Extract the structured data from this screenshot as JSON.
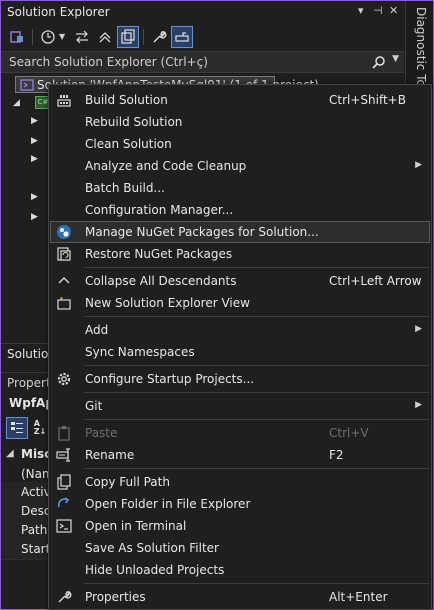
{
  "solution_explorer": {
    "title": "Solution Explorer",
    "title_controls": [
      "▾",
      "⊣",
      "✕"
    ],
    "search_placeholder": "Search Solution Explorer (Ctrl+ç)",
    "solution_node": "Solution 'WpfAppTesteMySql01' (1 of 1 project)",
    "bottom_tab": "Solution"
  },
  "diagnostic_tools": {
    "label": "Diagnostic Tools"
  },
  "properties": {
    "title": "Properti",
    "object": "WpfApp",
    "category": "Misc",
    "rows": [
      "(Nam",
      "Activ",
      "Descr",
      "Path",
      "Startu"
    ]
  },
  "context_menu": {
    "items": [
      {
        "label": "Build Solution",
        "shortcut": "Ctrl+Shift+B",
        "icon": "build-icon"
      },
      {
        "label": "Rebuild Solution",
        "shortcut": "",
        "icon": ""
      },
      {
        "label": "Clean Solution",
        "shortcut": "",
        "icon": ""
      },
      {
        "label": "Analyze and Code Cleanup",
        "shortcut": "",
        "icon": "",
        "submenu": true
      },
      {
        "label": "Batch Build...",
        "shortcut": "",
        "icon": ""
      },
      {
        "label": "Configuration Manager...",
        "shortcut": "",
        "icon": ""
      },
      {
        "label": "Manage NuGet Packages for Solution...",
        "shortcut": "",
        "icon": "nuget-icon",
        "highlighted": true
      },
      {
        "label": "Restore NuGet Packages",
        "shortcut": "",
        "icon": "restore-icon"
      },
      {
        "label": "Collapse All Descendants",
        "shortcut": "Ctrl+Left Arrow",
        "icon": "collapse-icon"
      },
      {
        "label": "New Solution Explorer View",
        "shortcut": "",
        "icon": "new-view-icon"
      },
      {
        "label": "Add",
        "shortcut": "",
        "icon": "",
        "submenu": true
      },
      {
        "label": "Sync Namespaces",
        "shortcut": "",
        "icon": ""
      },
      {
        "label": "Configure Startup Projects...",
        "shortcut": "",
        "icon": "gear-icon"
      },
      {
        "label": "Git",
        "shortcut": "",
        "icon": "",
        "submenu": true
      },
      {
        "label": "Paste",
        "shortcut": "Ctrl+V",
        "icon": "paste-icon",
        "disabled": true
      },
      {
        "label": "Rename",
        "shortcut": "F2",
        "icon": "rename-icon"
      },
      {
        "label": "Copy Full Path",
        "shortcut": "",
        "icon": "copy-icon"
      },
      {
        "label": "Open Folder in File Explorer",
        "shortcut": "",
        "icon": "open-folder-icon"
      },
      {
        "label": "Open in Terminal",
        "shortcut": "",
        "icon": "terminal-icon"
      },
      {
        "label": "Save As Solution Filter",
        "shortcut": "",
        "icon": ""
      },
      {
        "label": "Hide Unloaded Projects",
        "shortcut": "",
        "icon": ""
      },
      {
        "label": "Properties",
        "shortcut": "Alt+Enter",
        "icon": "wrench-icon"
      }
    ]
  },
  "colors": {
    "accent": "#8a5cd6",
    "background": "#1f1f1f",
    "menu_highlight": "#2d2d2d"
  }
}
